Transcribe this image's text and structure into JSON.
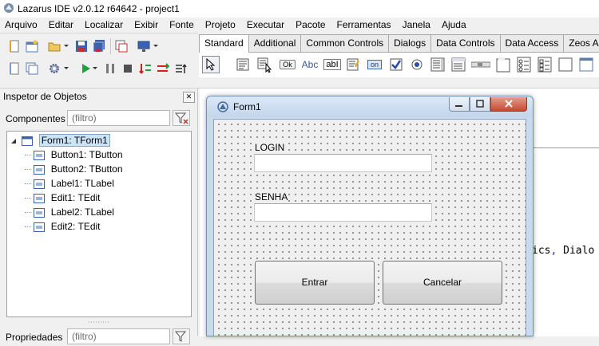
{
  "window": {
    "title": "Lazarus IDE v2.0.12 r64642 - project1"
  },
  "menu": [
    "Arquivo",
    "Editar",
    "Localizar",
    "Exibir",
    "Fonte",
    "Projeto",
    "Executar",
    "Pacote",
    "Ferramentas",
    "Janela",
    "Ajuda"
  ],
  "palette": {
    "tabs": [
      "Standard",
      "Additional",
      "Common Controls",
      "Dialogs",
      "Data Controls",
      "Data Access",
      "Zeos Ac"
    ],
    "active_tab": "Standard",
    "components": [
      "pointer-tool",
      "tmainmenu",
      "tpopupmenu",
      "tbutton",
      "tlabel",
      "tedit",
      "tmemo",
      "ttogglebox",
      "tcheckbox",
      "tradiobutton",
      "tlistbox",
      "tcombobox",
      "tscrollbar",
      "tgroupbox",
      "tradiogroup",
      "tcheckgroup",
      "tpanel",
      "tframe"
    ],
    "button_glyphs": {
      "tbutton": "Ok",
      "tlabel": "Abc",
      "tedit": "abI",
      "ttogglebox": "on"
    }
  },
  "inspector": {
    "title": "Inspetor de Objetos",
    "components_label": "Componentes",
    "filter_placeholder": "(filtro)",
    "properties_label": "Propriedades",
    "tree": [
      {
        "label": "Form1: TForm1",
        "level": 0,
        "selected": true
      },
      {
        "label": "Button1: TButton",
        "level": 1
      },
      {
        "label": "Button2: TButton",
        "level": 1
      },
      {
        "label": "Label1: TLabel",
        "level": 1
      },
      {
        "label": "Edit1: TEdit",
        "level": 1
      },
      {
        "label": "Label2: TLabel",
        "level": 1
      },
      {
        "label": "Edit2: TEdit",
        "level": 1
      }
    ]
  },
  "editor": {
    "visible_code_prefix": "ics",
    "visible_code_suffix": " Dialo"
  },
  "form": {
    "title": "Form1",
    "label1": "LOGIN",
    "label2": "SENHA",
    "edit1_value": "",
    "edit2_value": "",
    "button1": "Entrar",
    "button2": "Cancelar"
  },
  "colors": {
    "form_border": "#6f8fb4",
    "close_button": "#c64a34",
    "selection": "#cce4f7"
  }
}
